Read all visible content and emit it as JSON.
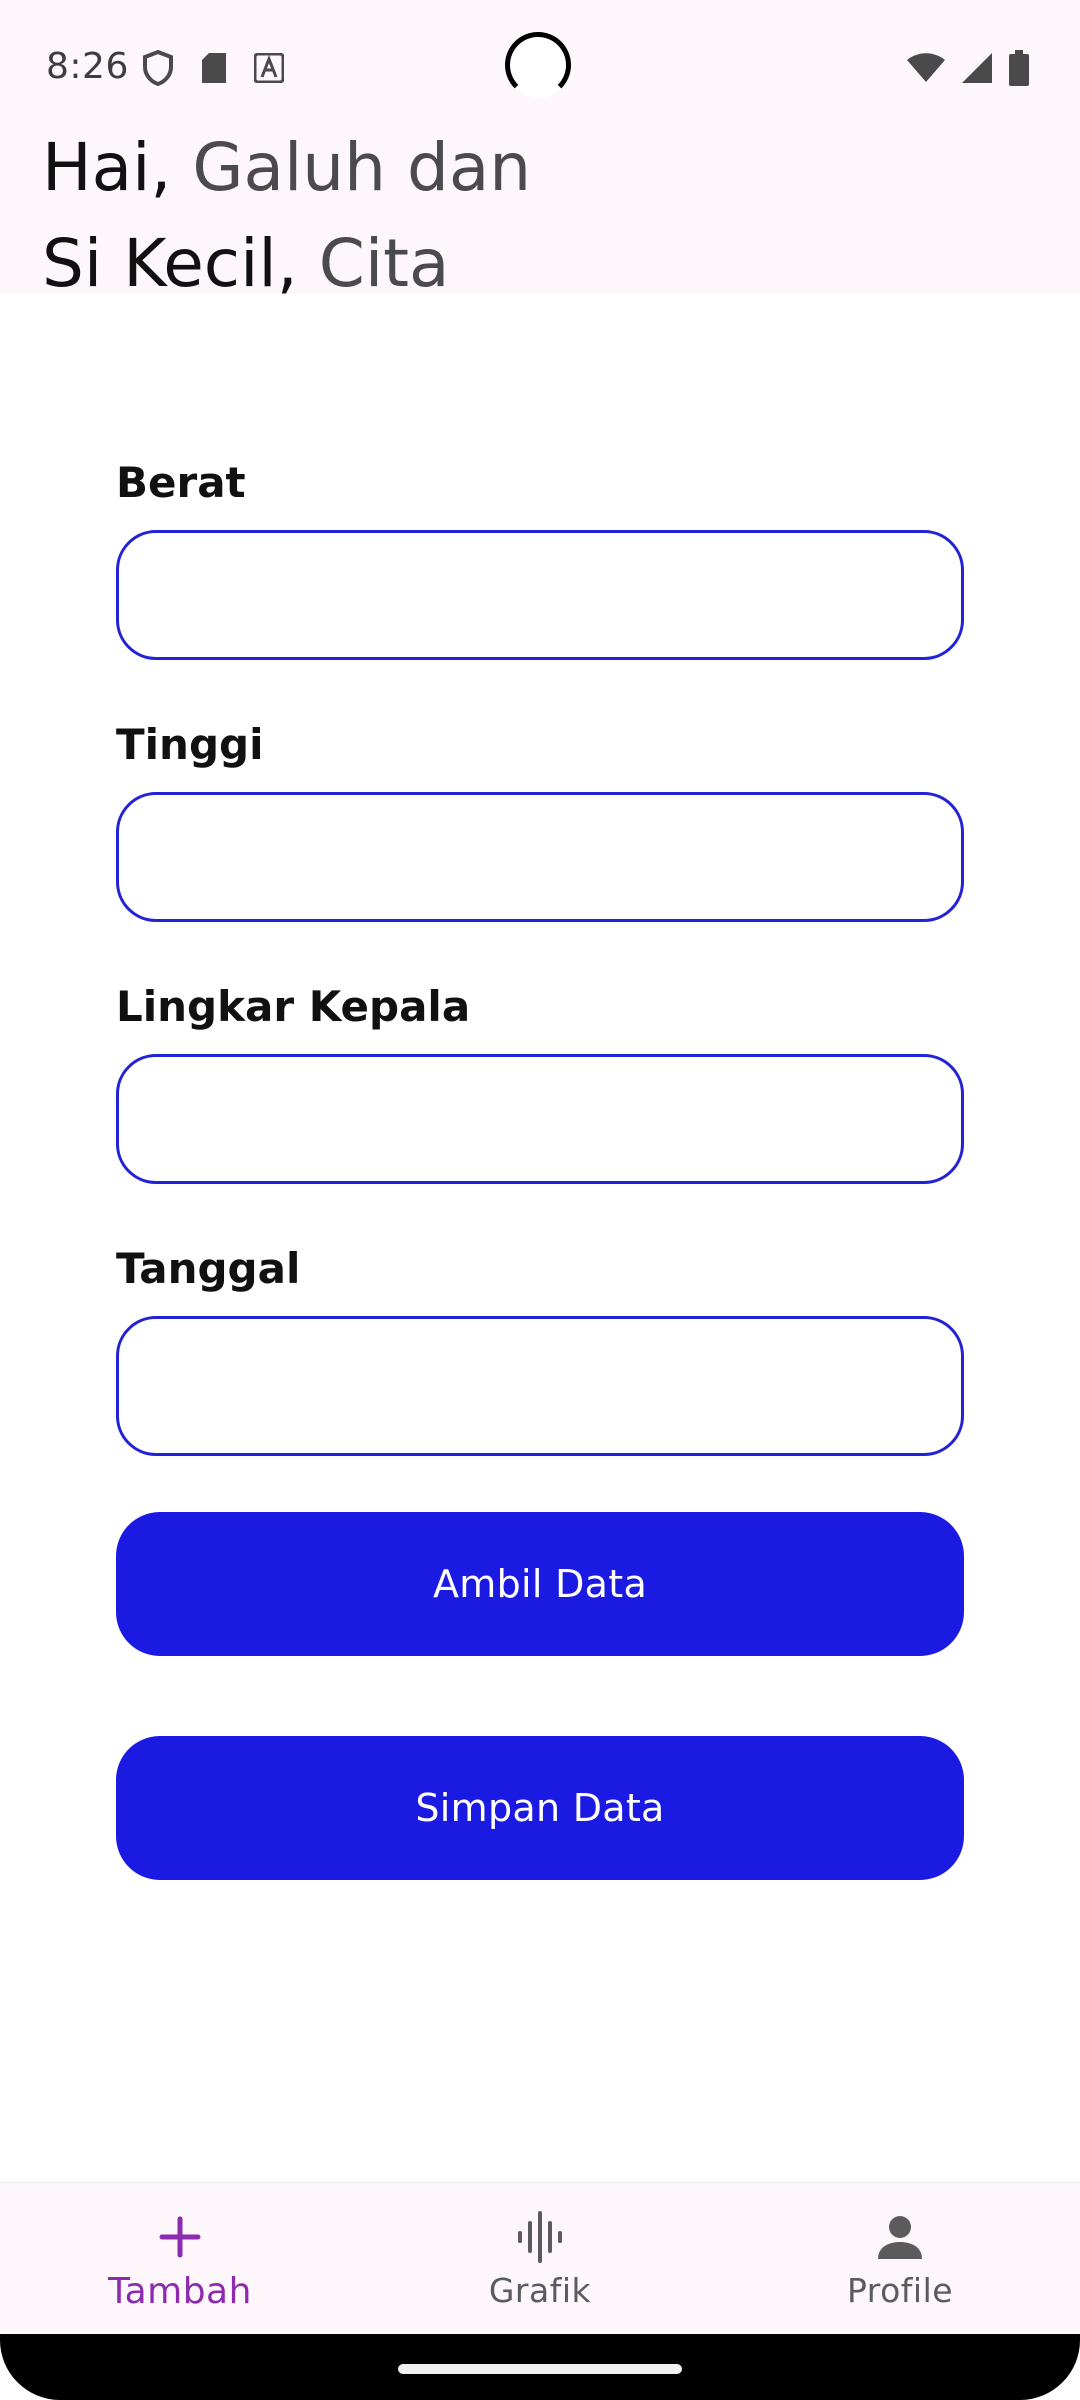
{
  "status_bar": {
    "time": "8:26",
    "icons_left": [
      "shield-icon",
      "sd-card-icon",
      "font-a-icon"
    ],
    "icons_right": [
      "wifi-icon",
      "signal-icon",
      "battery-icon"
    ]
  },
  "header": {
    "line1_strong": "Hai,",
    "line1_soft": "Galuh dan",
    "line2_strong": "Si Kecil,",
    "line2_soft": "Cita"
  },
  "form": {
    "fields": [
      {
        "label": "Berat",
        "value": "",
        "placeholder": ""
      },
      {
        "label": "Tinggi",
        "value": "",
        "placeholder": ""
      },
      {
        "label": "Lingkar Kepala",
        "value": "",
        "placeholder": ""
      },
      {
        "label": "Tanggal",
        "value": "",
        "placeholder": ""
      }
    ],
    "fetch_button": "Ambil Data",
    "save_button": "Simpan Data"
  },
  "bottom_nav": {
    "items": [
      {
        "label": "Tambah",
        "icon": "plus-icon",
        "active": true
      },
      {
        "label": "Grafik",
        "icon": "waveform-icon",
        "active": false
      },
      {
        "label": "Profile",
        "icon": "person-icon",
        "active": false
      }
    ]
  },
  "colors": {
    "accent": "#1a1ae3",
    "input_border": "#2222d6",
    "nav_active": "#8c2bb0",
    "surface": "#fdf7fc"
  }
}
